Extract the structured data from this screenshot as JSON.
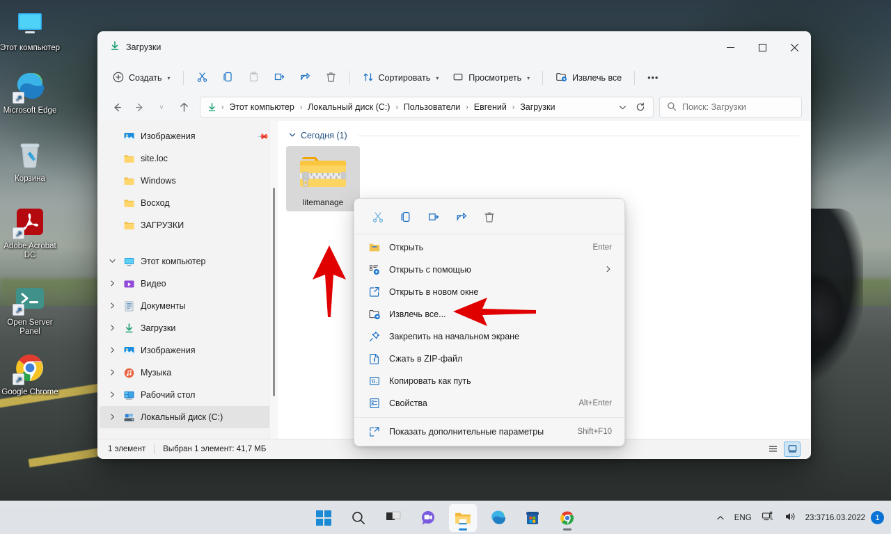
{
  "desktop": {
    "icons": [
      {
        "name": "Этот компьютер",
        "icon": "this-pc-icon",
        "shortcut": false
      },
      {
        "name": "Microsoft Edge",
        "icon": "edge-icon",
        "shortcut": true
      },
      {
        "name": "Корзина",
        "icon": "recycle-bin-icon",
        "shortcut": false
      },
      {
        "name": "Adobe Acrobat DC",
        "icon": "acrobat-icon",
        "shortcut": true
      },
      {
        "name": "Open Server Panel",
        "icon": "open-server-panel-icon",
        "shortcut": true
      },
      {
        "name": "Google Chrome",
        "icon": "chrome-icon",
        "shortcut": true
      }
    ]
  },
  "window": {
    "title": "Загрузки",
    "title_icon": "downloads-icon",
    "controls": {
      "minimize": "—",
      "maximize": "☐",
      "close": "✕"
    }
  },
  "toolbar": {
    "new_label": "Создать",
    "cut_label": "Вырезать",
    "copy_label": "Копировать",
    "paste_label": "Вставить",
    "rename_label": "Переименовать",
    "share_label": "Поделиться",
    "delete_label": "Удалить",
    "sort_label": "Сортировать",
    "view_label": "Просмотреть",
    "extract_all_label": "Извлечь все",
    "more_label": "•••"
  },
  "address": {
    "back": "←",
    "forward": "→",
    "recent": "∨",
    "up": "↑",
    "refresh": "⟳",
    "dropdown": "∨",
    "breadcrumbs": [
      "Этот компьютер",
      "Локальный диск (C:)",
      "Пользователи",
      "Евгений",
      "Загрузки"
    ],
    "separator": "›"
  },
  "search": {
    "placeholder": "Поиск: Загрузки",
    "icon": "search-icon"
  },
  "sidebar": {
    "quick_items": [
      {
        "label": "Изображения",
        "icon": "pictures-icon",
        "pinned": true,
        "twisty": ""
      },
      {
        "label": "site.loc",
        "icon": "folder-icon",
        "pinned": false,
        "twisty": ""
      },
      {
        "label": "Windows",
        "icon": "folder-icon",
        "pinned": false,
        "twisty": ""
      },
      {
        "label": "Восход",
        "icon": "folder-icon",
        "pinned": false,
        "twisty": ""
      },
      {
        "label": "ЗАГРУЗКИ",
        "icon": "folder-icon",
        "pinned": false,
        "twisty": ""
      }
    ],
    "this_pc": {
      "label": "Этот компьютер",
      "icon": "this-pc-icon",
      "twisty": "∨"
    },
    "pc_items": [
      {
        "label": "Видео",
        "icon": "videos-icon",
        "twisty": "›",
        "selected": false
      },
      {
        "label": "Документы",
        "icon": "documents-icon",
        "twisty": "›",
        "selected": false
      },
      {
        "label": "Загрузки",
        "icon": "downloads-icon",
        "twisty": "›",
        "selected": false
      },
      {
        "label": "Изображения",
        "icon": "pictures-icon",
        "twisty": "›",
        "selected": false
      },
      {
        "label": "Музыка",
        "icon": "music-icon",
        "twisty": "›",
        "selected": false
      },
      {
        "label": "Рабочий стол",
        "icon": "desktop-icon",
        "twisty": "›",
        "selected": false
      },
      {
        "label": "Локальный диск (C:)",
        "icon": "drive-icon",
        "twisty": "›",
        "selected": true
      }
    ]
  },
  "content": {
    "group_header": "Сегодня (1)",
    "group_chevron": "∨",
    "files": [
      {
        "name": "litemanage",
        "icon": "zip-folder-icon",
        "selected": true
      }
    ]
  },
  "statusbar": {
    "item_count": "1 элемент",
    "selection": "Выбран 1 элемент: 41,7 МБ",
    "view_list": "list-view-icon",
    "view_details": "large-icons-view-icon"
  },
  "context_menu": {
    "top_actions": [
      {
        "name": "cut-icon",
        "label": "Вырезать"
      },
      {
        "name": "copy-icon",
        "label": "Копировать"
      },
      {
        "name": "rename-icon",
        "label": "Переименовать"
      },
      {
        "name": "share-icon",
        "label": "Поделиться"
      },
      {
        "name": "delete-icon",
        "label": "Удалить"
      }
    ],
    "items": [
      {
        "label": "Открыть",
        "icon": "open-folder-icon",
        "accel": "Enter",
        "submenu": false
      },
      {
        "label": "Открыть с помощью",
        "icon": "open-with-icon",
        "accel": "",
        "submenu": true
      },
      {
        "label": "Открыть в новом окне",
        "icon": "new-window-icon",
        "accel": "",
        "submenu": false
      },
      {
        "label": "Извлечь все...",
        "icon": "extract-all-icon",
        "accel": "",
        "submenu": false
      },
      {
        "label": "Закрепить на начальном экране",
        "icon": "pin-icon",
        "accel": "",
        "submenu": false
      },
      {
        "label": "Сжать в ZIP-файл",
        "icon": "zip-icon",
        "accel": "",
        "submenu": false
      },
      {
        "label": "Копировать как путь",
        "icon": "copy-path-icon",
        "accel": "",
        "submenu": false
      },
      {
        "label": "Свойства",
        "icon": "properties-icon",
        "accel": "Alt+Enter",
        "submenu": false
      },
      {
        "label": "Показать дополнительные параметры",
        "icon": "more-options-icon",
        "accel": "Shift+F10",
        "submenu": false
      }
    ]
  },
  "taskbar": {
    "apps": [
      {
        "name": "start-button",
        "icon": "windows-logo-icon",
        "active": false,
        "running": false
      },
      {
        "name": "search-button",
        "icon": "search-icon",
        "active": false,
        "running": false
      },
      {
        "name": "task-view-button",
        "icon": "task-view-icon",
        "active": false,
        "running": false
      },
      {
        "name": "chat-button",
        "icon": "chat-icon",
        "active": false,
        "running": false
      },
      {
        "name": "file-explorer-button",
        "icon": "file-explorer-icon",
        "active": true,
        "running": true
      },
      {
        "name": "edge-button",
        "icon": "edge-icon",
        "active": false,
        "running": false
      },
      {
        "name": "store-button",
        "icon": "microsoft-store-icon",
        "active": false,
        "running": false
      },
      {
        "name": "chrome-button",
        "icon": "chrome-icon",
        "active": false,
        "running": true
      }
    ],
    "tray": {
      "overflow": "∧",
      "language": "ENG",
      "network_icon": "network-icon",
      "volume_icon": "volume-icon",
      "time": "23:37",
      "date": "16.03.2022",
      "notification_count": "1"
    }
  },
  "annotations": {
    "arrow_color": "#e00000",
    "arrows": [
      {
        "name": "arrow-pointing-to-file",
        "direction": "up"
      },
      {
        "name": "arrow-pointing-to-extract-all",
        "direction": "left"
      }
    ]
  },
  "colors": {
    "accent": "#0a72d4",
    "window_bg": "#f3f3f3",
    "selection": "#d8d8d8",
    "group_header": "#1b4d7e"
  }
}
